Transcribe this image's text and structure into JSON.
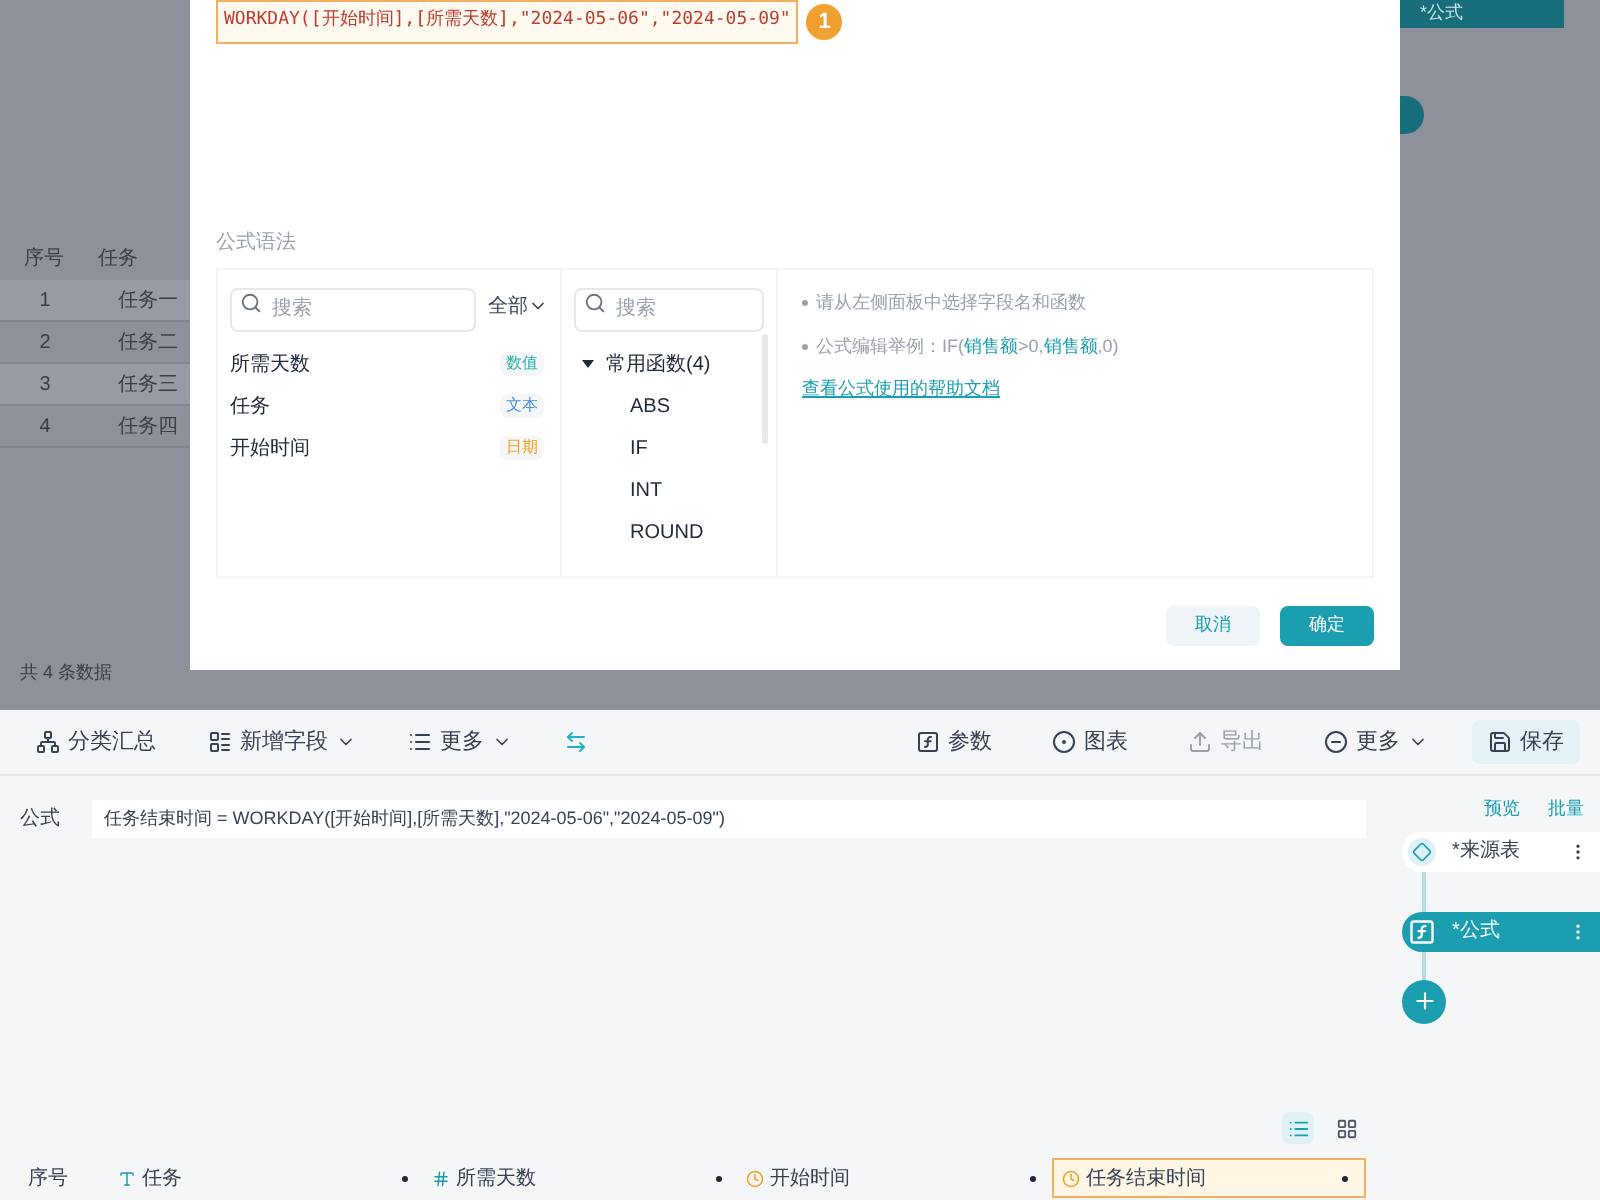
{
  "background": {
    "table": {
      "columns": [
        "序号",
        "任务"
      ],
      "rows": [
        [
          "1",
          "任务一"
        ],
        [
          "2",
          "任务二"
        ],
        [
          "3",
          "任务三"
        ],
        [
          "4",
          "任务四"
        ]
      ]
    },
    "footer": "共 4 条数据",
    "node": {
      "label": "*公式"
    }
  },
  "dialog": {
    "formula": "WORKDAY([开始时间],[所需天数],\"2024-05-06\",\"2024-05-09\"",
    "step_badge": "1",
    "syntax_label": "公式语法",
    "fields": {
      "search_placeholder": "搜索",
      "filter": "全部",
      "items": [
        {
          "name": "所需天数",
          "type": "数值",
          "color": "#2bb3a3"
        },
        {
          "name": "任务",
          "type": "文本",
          "color": "#4a90e2"
        },
        {
          "name": "开始时间",
          "type": "日期",
          "color": "#f0a020"
        }
      ]
    },
    "functions": {
      "search_placeholder": "搜索",
      "groups": [
        {
          "label": "常用函数(4)",
          "expanded": true,
          "children": [
            "ABS",
            "IF",
            "INT",
            "ROUND"
          ]
        }
      ]
    },
    "help": {
      "hint": "请从左侧面板中选择字段名和函数",
      "example": {
        "prefix": "公式编辑举例：IF(",
        "field_1": "销售额",
        "middle": ">0,",
        "field_2": "销售额",
        "suffix": ",0)"
      },
      "link": "查看公式使用的帮助文档"
    },
    "buttons": [
      {
        "label": "取消",
        "kind": "secondary"
      },
      {
        "label": "确定",
        "kind": "primary"
      }
    ]
  },
  "toolbar": {
    "left": [
      {
        "label": "分类汇总",
        "kind": "tree",
        "dropdown": false
      },
      {
        "label": "新增字段",
        "kind": "field",
        "dropdown": true
      },
      {
        "label": "更多",
        "kind": "list",
        "dropdown": true
      },
      {
        "kind": "swap",
        "dropdown": false
      }
    ],
    "right": [
      {
        "label": "参数",
        "kind": "param",
        "dropdown": false,
        "disabled": false
      },
      {
        "label": "图表",
        "kind": "chart",
        "dropdown": false,
        "disabled": false
      },
      {
        "label": "导出",
        "kind": "export",
        "dropdown": false,
        "disabled": true
      },
      {
        "label": "更多",
        "kind": "more",
        "dropdown": true,
        "disabled": false
      },
      {
        "label": "保存",
        "kind": "save",
        "dropdown": false,
        "disabled": false
      }
    ]
  },
  "formula_bar": {
    "label": "公式",
    "value": "任务结束时间 = WORKDAY([开始时间],[所需天数],\"2024-05-06\",\"2024-05-09\")"
  },
  "flow": {
    "links": [
      "预览",
      "批量"
    ],
    "nodes": [
      {
        "label": "*来源表",
        "kind": "source",
        "selected": false
      },
      {
        "label": "*公式",
        "kind": "formula",
        "selected": true
      }
    ]
  },
  "view_toggle": [
    {
      "kind": "list",
      "selected": true
    },
    {
      "kind": "grid",
      "selected": false
    }
  ],
  "grid": {
    "columns": [
      {
        "label": "序号",
        "kind": "index",
        "selected": false
      },
      {
        "label": "任务",
        "kind": "text",
        "selected": false
      },
      {
        "label": "所需天数",
        "kind": "number",
        "selected": false
      },
      {
        "label": "开始时间",
        "kind": "date",
        "selected": false
      },
      {
        "label": "任务结束时间",
        "kind": "date",
        "selected": true
      }
    ]
  }
}
